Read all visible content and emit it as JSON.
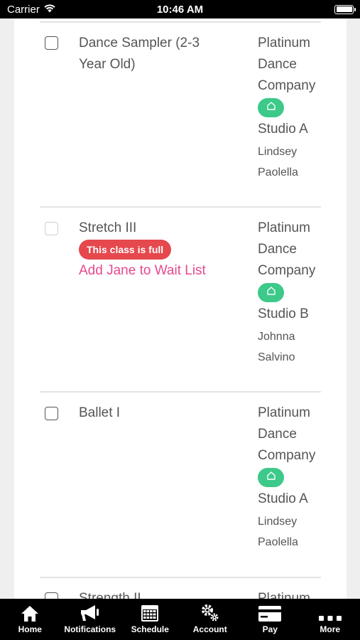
{
  "status_bar": {
    "carrier": "Carrier",
    "time": "10:46 AM"
  },
  "classes": [
    {
      "name": "Dance Sampler (2-3 Year Old)",
      "company": "Platinum Dance Company",
      "studio": "Studio A",
      "teacher": "Lindsey Paolella",
      "full": false
    },
    {
      "name": "Stretch III",
      "full": true,
      "full_badge": "This class is full",
      "waitlist_link": "Add Jane to Wait List",
      "company": "Platinum Dance Company",
      "studio": "Studio B",
      "teacher": "Johnna Salvino"
    },
    {
      "name": "Ballet I",
      "company": "Platinum Dance Company",
      "studio": "Studio A",
      "teacher": "Lindsey Paolella",
      "full": false
    },
    {
      "name": "Strength II",
      "company": "Platinum",
      "full": false
    }
  ],
  "tab_bar": {
    "tabs": [
      {
        "label": "Home",
        "icon": "home-icon"
      },
      {
        "label": "Notifications",
        "icon": "megaphone-icon"
      },
      {
        "label": "Schedule",
        "icon": "calendar-icon"
      },
      {
        "label": "Account",
        "icon": "gears-icon"
      },
      {
        "label": "Pay",
        "icon": "credit-card-icon"
      },
      {
        "label": "More",
        "icon": "ellipsis-icon"
      }
    ]
  },
  "colors": {
    "accent_pink": "#e8488f",
    "full_red": "#e5484d",
    "home_green": "#3cc98a"
  }
}
